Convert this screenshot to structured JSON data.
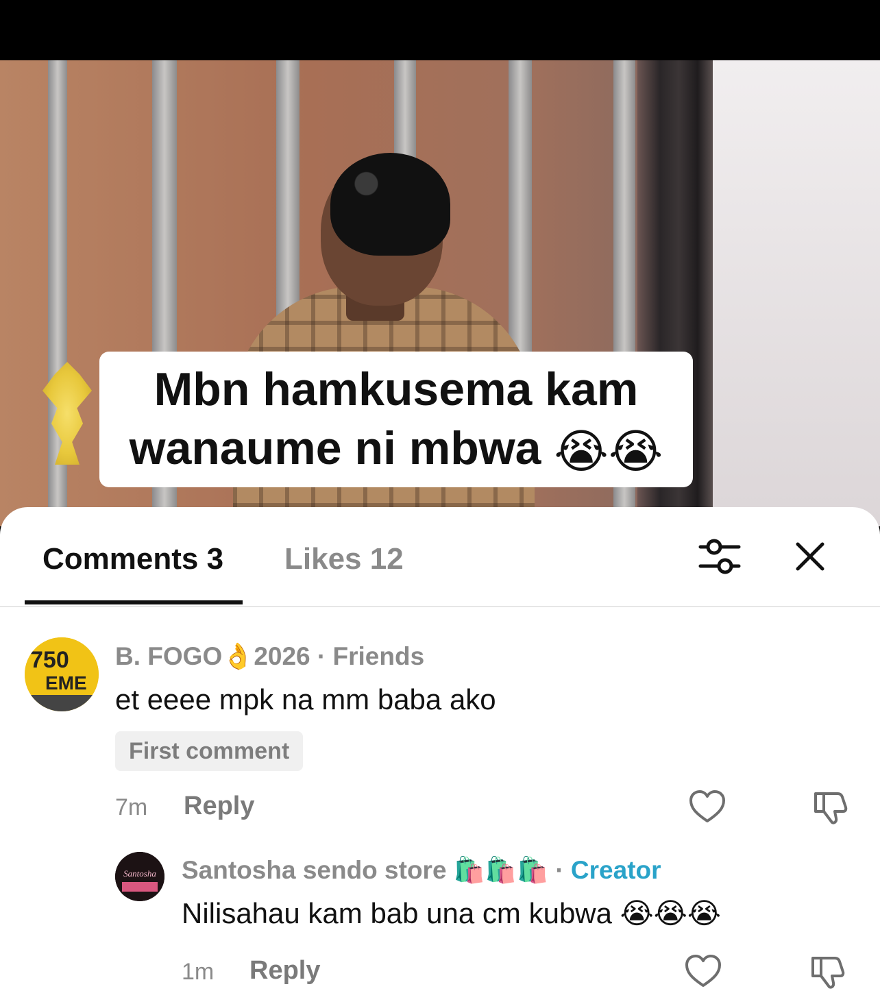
{
  "video": {
    "caption_line1": "Mbn hamkusema kam",
    "caption_line2": "wanaume ni mbwa",
    "caption_emoji": "😭😭"
  },
  "sheet": {
    "tabs": [
      {
        "label": "Comments 3",
        "active": true
      },
      {
        "label": "Likes 12",
        "active": false
      }
    ],
    "filter_icon": "filter-sliders-icon",
    "close_icon": "close-icon"
  },
  "comments": [
    {
      "username": "B. FOGO",
      "username_emoji": "👌",
      "username_suffix": "2026",
      "relation": "· Friends",
      "text": "et eeee mpk na mm baba ako",
      "badge": "First comment",
      "time": "7m",
      "reply_label": "Reply",
      "avatar_text_line1": "750",
      "avatar_text_line2": "EME",
      "avatar_text_prefix": "\\"
    },
    {
      "username": "Santosha sendo store",
      "username_emoji": "🛍️🛍️🛍️",
      "relation_dot": "·",
      "relation": "Creator",
      "text": "Nilisahau kam bab una cm kubwa",
      "text_emoji": "😭😭😭",
      "time": "1m",
      "reply_label": "Reply",
      "avatar_text": "Santosha"
    }
  ],
  "colors": {
    "creator_accent": "#2aa3c9",
    "muted_text": "#8a8a8a",
    "primary_text": "#111111"
  }
}
